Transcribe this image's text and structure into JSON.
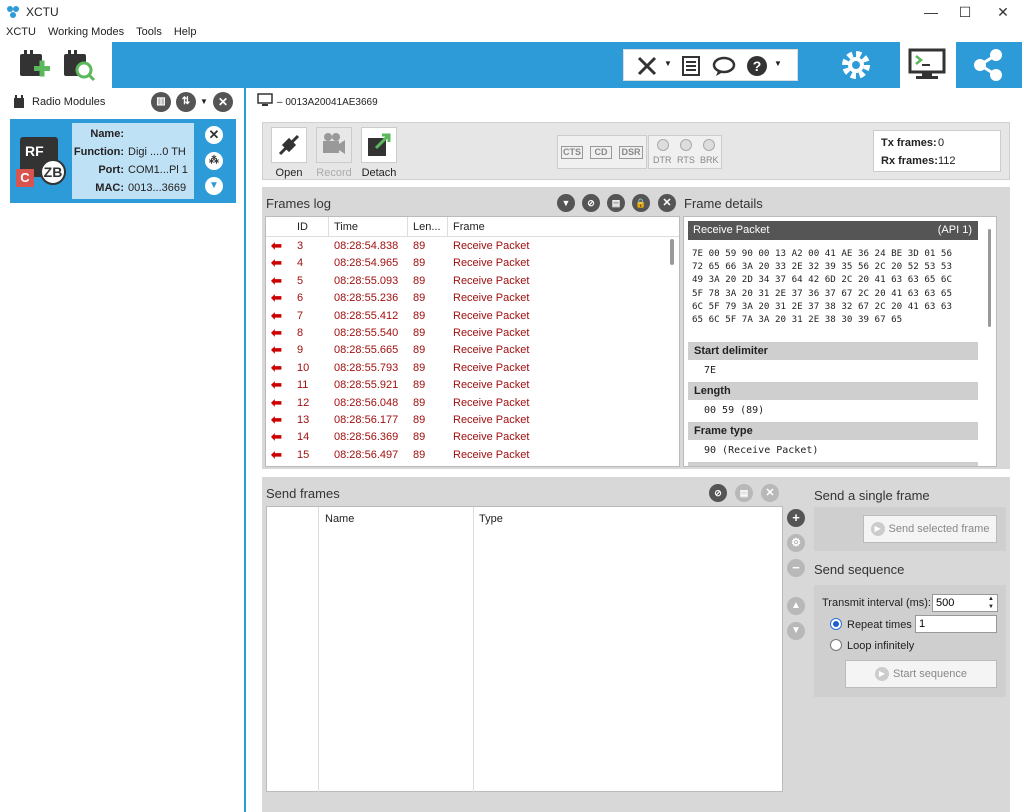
{
  "window": {
    "title": "XCTU",
    "controls": [
      "—",
      "☐",
      "✕"
    ]
  },
  "menu": [
    "XCTU",
    "Working Modes",
    "Tools",
    "Help"
  ],
  "left_panel": {
    "title": "Radio Modules",
    "module": {
      "badge": "ZB",
      "badge_letter": "C",
      "fields": [
        {
          "k": "Name:",
          "v": ""
        },
        {
          "k": "Function:",
          "v": "Digi ....0 TH"
        },
        {
          "k": "Port:",
          "v": "COM1...Pl 1"
        },
        {
          "k": "MAC:",
          "v": "0013...3669"
        }
      ]
    }
  },
  "device": {
    "address": "0013A20041AE3669"
  },
  "controls": {
    "open": "Open",
    "record": "Record",
    "detach": "Detach",
    "signals": [
      "CTS",
      "CD",
      "DSR"
    ],
    "leds": [
      "DTR",
      "RTS",
      "BRK"
    ],
    "tx_label": "Tx frames:",
    "tx_value": "0",
    "rx_label": "Rx frames:",
    "rx_value": "112"
  },
  "frames_log": {
    "title": "Frames log",
    "columns": [
      "ID",
      "Time",
      "Len...",
      "Frame"
    ],
    "rows": [
      {
        "id": "3",
        "time": "08:28:54.838",
        "len": "89",
        "frame": "Receive Packet"
      },
      {
        "id": "4",
        "time": "08:28:54.965",
        "len": "89",
        "frame": "Receive Packet"
      },
      {
        "id": "5",
        "time": "08:28:55.093",
        "len": "89",
        "frame": "Receive Packet"
      },
      {
        "id": "6",
        "time": "08:28:55.236",
        "len": "89",
        "frame": "Receive Packet"
      },
      {
        "id": "7",
        "time": "08:28:55.412",
        "len": "89",
        "frame": "Receive Packet"
      },
      {
        "id": "8",
        "time": "08:28:55.540",
        "len": "89",
        "frame": "Receive Packet"
      },
      {
        "id": "9",
        "time": "08:28:55.665",
        "len": "89",
        "frame": "Receive Packet"
      },
      {
        "id": "10",
        "time": "08:28:55.793",
        "len": "89",
        "frame": "Receive Packet"
      },
      {
        "id": "11",
        "time": "08:28:55.921",
        "len": "89",
        "frame": "Receive Packet"
      },
      {
        "id": "12",
        "time": "08:28:56.048",
        "len": "89",
        "frame": "Receive Packet"
      },
      {
        "id": "13",
        "time": "08:28:56.177",
        "len": "89",
        "frame": "Receive Packet"
      },
      {
        "id": "14",
        "time": "08:28:56.369",
        "len": "89",
        "frame": "Receive Packet"
      },
      {
        "id": "15",
        "time": "08:28:56.497",
        "len": "89",
        "frame": "Receive Packet"
      }
    ]
  },
  "frame_details": {
    "title": "Frame details",
    "header": "Receive Packet",
    "api": "(API 1)",
    "hex_lines": [
      "7E 00 59 90 00 13 A2 00 41 AE 36 24 BE 3D 01 56",
      "72 65 66 3A 20 33 2E 32 39 35 56 2C 20 52 53 53",
      "49 3A 20 2D 34 37 64 42 6D 2C 20 41 63 63 65 6C",
      "5F 78 3A 20 31 2E 37 36 37 67 2C 20 41 63 63 65",
      "6C 5F 79 3A 20 31 2E 37 38 32 67 2C 20 41 63 63",
      "65 6C 5F 7A 3A 20 31 2E 38 30 39 67 65"
    ],
    "fields": [
      {
        "name": "Start delimiter",
        "value": "7E"
      },
      {
        "name": "Length",
        "value": "00 59 (89)"
      },
      {
        "name": "Frame type",
        "value": "90 (Receive Packet)"
      }
    ]
  },
  "send_frames": {
    "title": "Send frames",
    "columns": [
      "Name",
      "Type"
    ],
    "single_title": "Send a single frame",
    "send_selected": "Send selected frame",
    "sequence_title": "Send sequence",
    "interval_label": "Transmit interval (ms):",
    "interval_value": "500",
    "repeat_label": "Repeat times",
    "repeat_value": "1",
    "loop_label": "Loop infinitely",
    "start_sequence": "Start sequence"
  }
}
